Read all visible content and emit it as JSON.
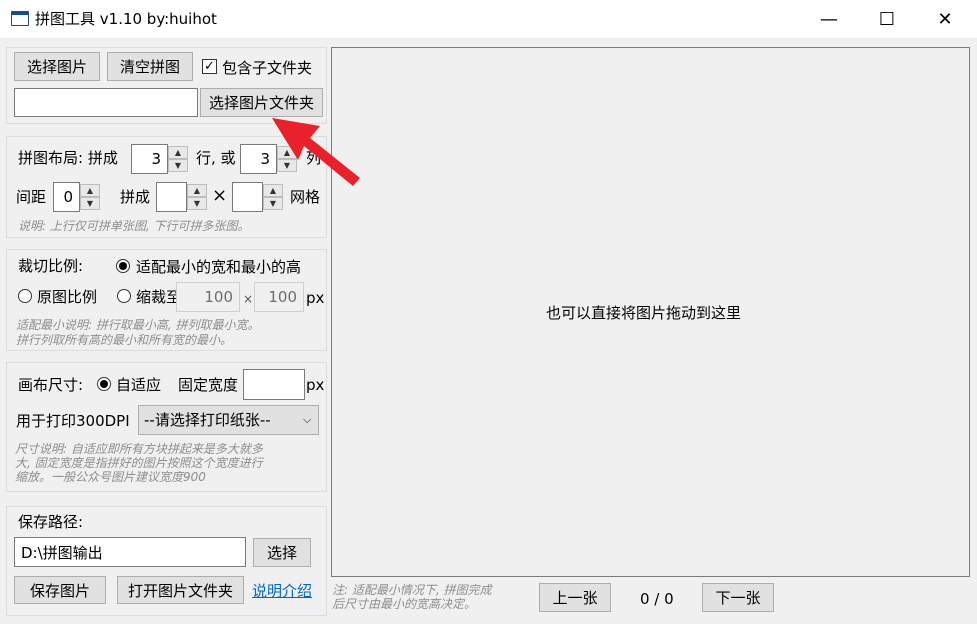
{
  "window": {
    "title": "拼图工具 v1.10 by:huihot",
    "minimize_glyph": "—",
    "maximize_glyph": "☐",
    "close_glyph": "✕"
  },
  "source": {
    "select_images": "选择图片",
    "clear_images": "清空拼图",
    "include_subfolders": "包含子文件夹",
    "include_subfolders_checked": true,
    "folder_path": "",
    "select_folder": "选择图片文件夹"
  },
  "layout": {
    "label": "拼图布局: 拼成",
    "rows": "3",
    "rows_suffix": "行, 或",
    "cols": "3",
    "cols_suffix": "列",
    "spacing_label": "间距",
    "spacing": "0",
    "grid_label": "拼成",
    "grid_w": "",
    "times": "×",
    "grid_h": "",
    "grid_suffix": "网格",
    "note": "说明: 上行仅可拼单张图, 下行可拼多张图。"
  },
  "crop": {
    "label": "裁切比例:",
    "fit_min": "适配最小的宽和最小的高",
    "original": "原图比例",
    "crop_to": "缩裁至",
    "crop_w": "100",
    "times": "×",
    "crop_h": "100",
    "unit": "px",
    "selected": "fit_min",
    "note_line1": "适配最小说明: 拼行取最小高, 拼列取最小宽。",
    "note_line2": "拼行列取所有高的最小和所有宽的最小。"
  },
  "canvas": {
    "label": "画布尺寸:",
    "auto": "自适应",
    "fixed_width": "固定宽度",
    "fixed_value": "",
    "unit": "px",
    "print_label": "用于打印300DPI",
    "paper_select": "--请选择打印纸张--",
    "note_line1": "尺寸说明: 自适应即所有方块拼起来是多大就多",
    "note_line2": "大, 固定宽度是指拼好的图片按照这个宽度进行",
    "note_line3": "缩放。一般公众号图片建议宽度900"
  },
  "save": {
    "label": "保存路径:",
    "path": "D:\\拼图输出",
    "choose": "选择",
    "save_image": "保存图片",
    "open_folder": "打开图片文件夹",
    "help_link": "说明介绍"
  },
  "preview": {
    "drop_hint": "也可以直接将图片拖动到这里",
    "footer_note_line1": "注: 适配最小情况下, 拼图完成",
    "footer_note_line2": "后尺寸由最小的宽高决定。",
    "prev": "上一张",
    "counter": "0 / 0",
    "next": "下一张"
  },
  "colors": {
    "arrow": "#e8212a",
    "link": "#0066cc"
  }
}
